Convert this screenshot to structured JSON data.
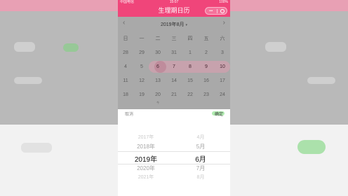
{
  "status_bar": {
    "carrier": "中国电信",
    "time": "15:07",
    "battery": "100%"
  },
  "nav": {
    "title": "生理期日历",
    "capsule_dots": "•••"
  },
  "calendar": {
    "prev_arrow": "‹",
    "next_arrow": "›",
    "month_label": "2019年8月",
    "month_caret": "▾",
    "weekdays": [
      "日",
      "一",
      "二",
      "三",
      "四",
      "五",
      "六"
    ],
    "weeks": [
      [
        "28",
        "29",
        "30",
        "31",
        "1",
        "2",
        "3"
      ],
      [
        "4",
        "5",
        "6",
        "7",
        "8",
        "9",
        "10"
      ],
      [
        "11",
        "12",
        "13",
        "14",
        "15",
        "16",
        "17"
      ],
      [
        "18",
        "19",
        "20",
        "21",
        "22",
        "23",
        "24"
      ]
    ],
    "today_marker": "今"
  },
  "picker": {
    "cancel_label": "取消",
    "confirm_label": "确定",
    "years": [
      "2017年",
      "2018年",
      "2019年",
      "2020年",
      "2021年"
    ],
    "months": [
      "4月",
      "5月",
      "6月",
      "7月",
      "8月"
    ],
    "selected_year_index": 2,
    "selected_month_index": 2
  },
  "colors": {
    "brand": "#f0457a",
    "accent_green": "#7bd67b"
  }
}
